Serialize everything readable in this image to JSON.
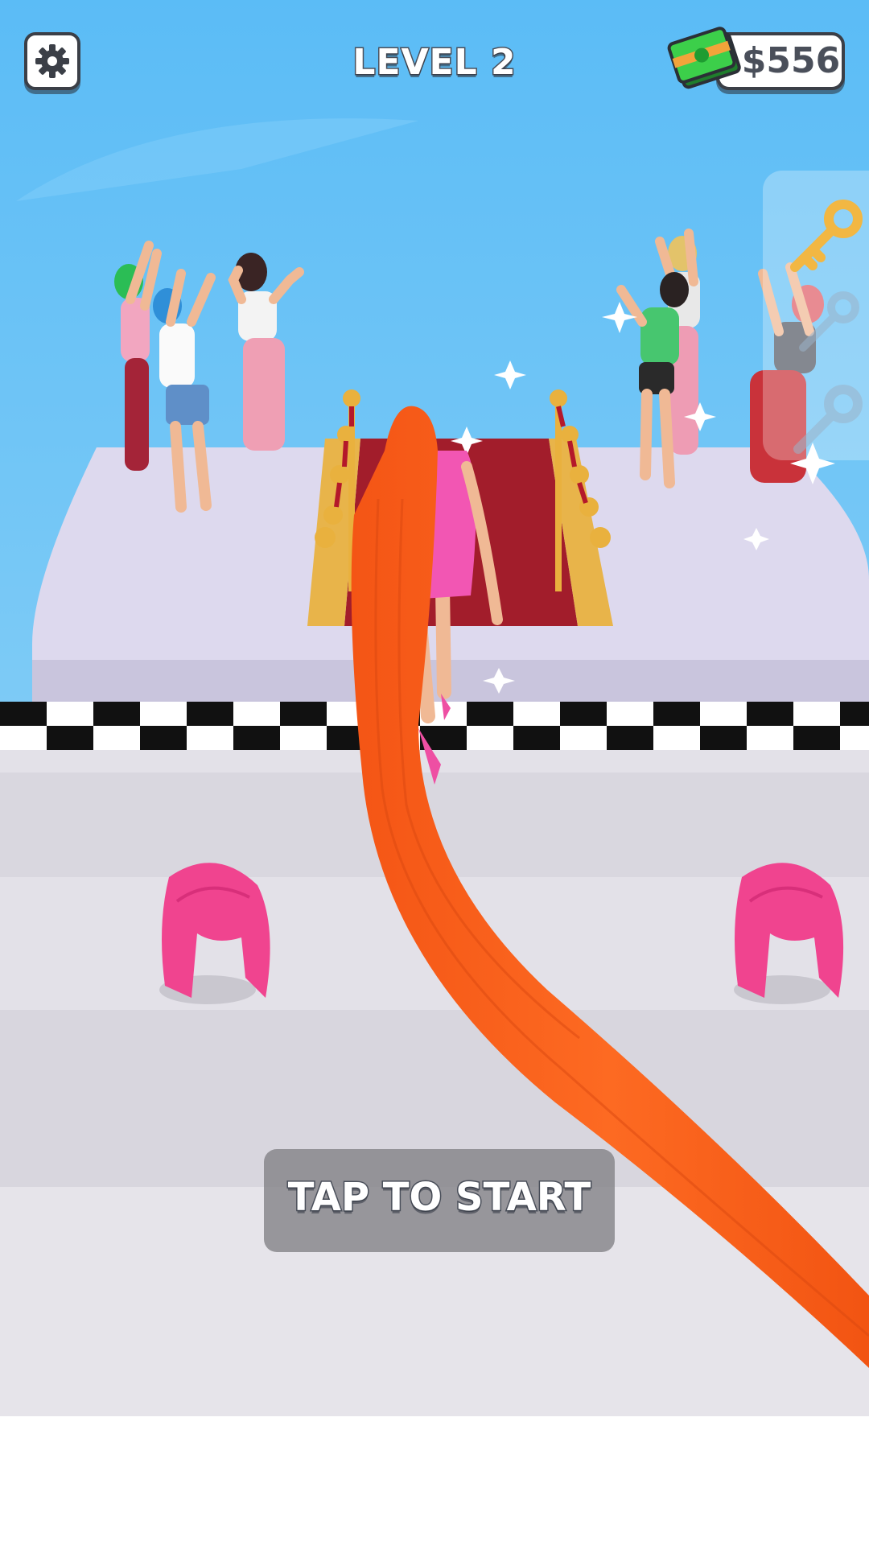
{
  "hud": {
    "level_label": "LEVEL 2",
    "cash": "$556",
    "settings_icon": "gear-icon",
    "cash_icon": "money-stack-icon"
  },
  "side_panel": {
    "keys_collected": 1,
    "keys_total": 3,
    "key_icon": "key-icon"
  },
  "prompt": {
    "tap_label": "TAP TO START"
  },
  "scene": {
    "pickups": [
      "pink-wig",
      "pink-wig"
    ],
    "colors": {
      "sky": "#5fbef6",
      "hair": "#fb5f1c",
      "carpet": "#a21d2b",
      "wig": "#f0448f",
      "stage": "#ddd9ee",
      "runway": "#e1dfe6"
    }
  }
}
